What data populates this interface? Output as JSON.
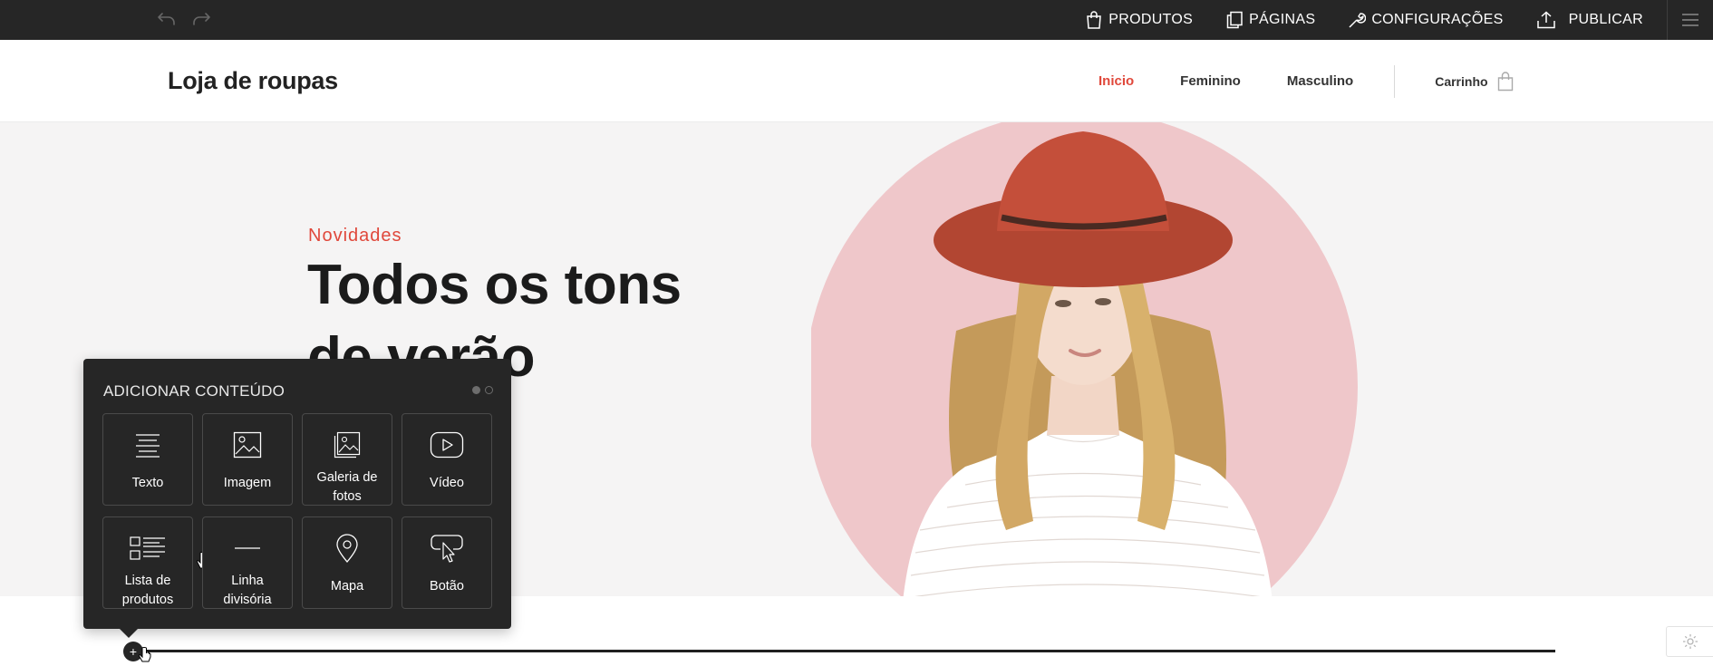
{
  "editor_bar": {
    "undo_icon": "undo-icon",
    "redo_icon": "redo-icon",
    "nav": [
      {
        "label": "PRODUTOS",
        "icon": "shopping-bag-icon"
      },
      {
        "label": "PÁGINAS",
        "icon": "pages-icon"
      },
      {
        "label": "CONFIGURAÇÕES",
        "icon": "wrench-icon"
      },
      {
        "label": "PUBLICAR",
        "icon": "upload-icon"
      }
    ],
    "menu_icon": "hamburger-menu-icon",
    "background": "#262626"
  },
  "site": {
    "brand": "Loja de roupas",
    "nav": [
      {
        "label": "Inicio",
        "active": true
      },
      {
        "label": "Feminino",
        "active": false
      },
      {
        "label": "Masculino",
        "active": false
      }
    ],
    "cart_label": "Carrinho",
    "cart_icon": "shopping-bag-icon",
    "accent": "#e0483b"
  },
  "hero": {
    "kicker": "Novidades",
    "title": "Todos os tons de verão",
    "circle_color": "#efc7ca"
  },
  "add_content": {
    "title": "ADICIONAR CONTEÚDO",
    "page_current": 1,
    "page_total": 2,
    "tiles": [
      {
        "label": "Texto",
        "icon": "text-icon"
      },
      {
        "label": "Imagem",
        "icon": "image-icon"
      },
      {
        "label": "Galeria de fotos",
        "icon": "gallery-icon"
      },
      {
        "label": "Vídeo",
        "icon": "video-play-icon"
      },
      {
        "label": "Lista de produtos",
        "icon": "product-list-icon"
      },
      {
        "label": "Linha divisória",
        "icon": "divider-line-icon"
      },
      {
        "label": "Mapa",
        "icon": "map-pin-icon"
      },
      {
        "label": "Botão",
        "icon": "button-click-icon"
      }
    ]
  },
  "section_controls": {
    "add_label": "+",
    "settings_icon": "gear-icon"
  }
}
